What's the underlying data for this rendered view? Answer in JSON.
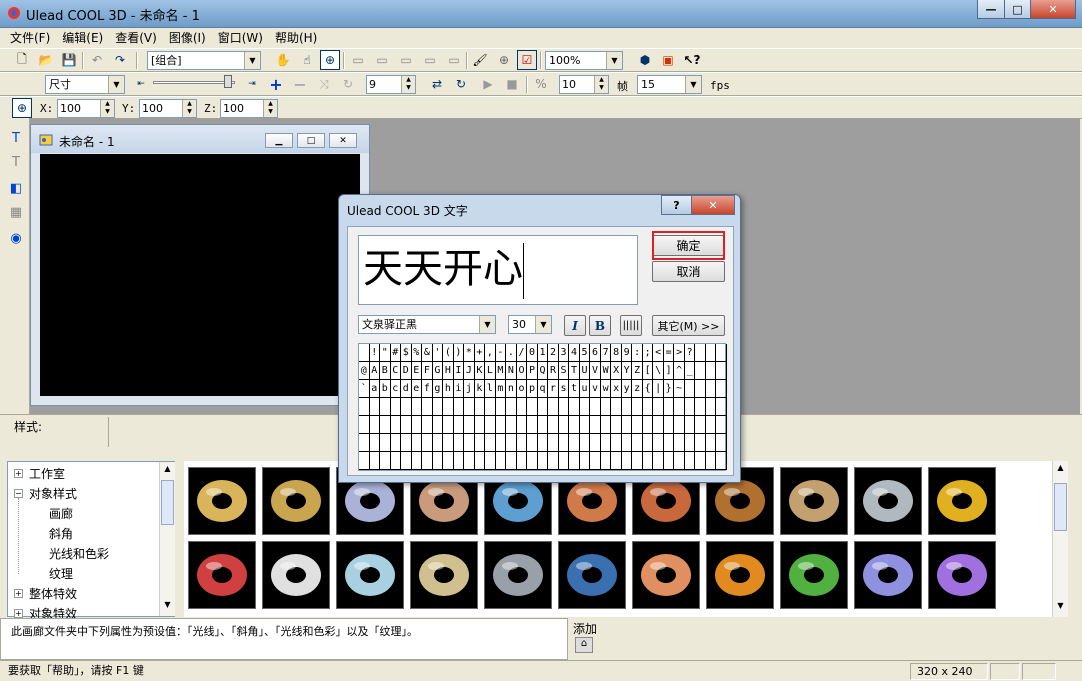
{
  "window": {
    "title": "Ulead COOL 3D - 未命名 - 1",
    "min": "—",
    "max": "□",
    "close": "✕"
  },
  "menu": [
    "文件(F)",
    "编辑(E)",
    "查看(V)",
    "图像(I)",
    "窗口(W)",
    "帮助(H)"
  ],
  "toolbar1": {
    "object_combo": "[组合]",
    "zoom_combo": "100%"
  },
  "toolbar2": {
    "size_combo": "尺寸",
    "frame_value": "9",
    "frames_total": "10",
    "frame_label": "帧",
    "fps_value": "15",
    "fps_label": "fps"
  },
  "toolbar3": {
    "x_label": "X:",
    "x_value": "100",
    "y_label": "Y:",
    "y_value": "100",
    "z_label": "Z:",
    "z_value": "100"
  },
  "doc": {
    "title": "未命名 - 1"
  },
  "style_label": "样式:",
  "tree": {
    "items": [
      {
        "label": "工作室",
        "expander": "+"
      },
      {
        "label": "对象样式",
        "expander": "−"
      },
      {
        "label": "画廊",
        "expander": ""
      },
      {
        "label": "斜角",
        "expander": ""
      },
      {
        "label": "光线和色彩",
        "expander": ""
      },
      {
        "label": "纹理",
        "expander": ""
      },
      {
        "label": "整体特效",
        "expander": "+"
      },
      {
        "label": "对象特效",
        "expander": "+"
      }
    ]
  },
  "thumbs": {
    "row1": [
      "#d9b45a",
      "#c9a550",
      "#aab2d8",
      "#c99a7c",
      "#5c9fd0",
      "#d07a4a",
      "#c8683c",
      "#b07030",
      "#c2a070",
      "#b0b8c0",
      "#e0b020"
    ],
    "row2": [
      "#d04040",
      "#e0e0e0",
      "#a8d0e0",
      "#d0c090",
      "#9aa0a8",
      "#3a70b0",
      "#e09060",
      "#e08a20",
      "#50b040",
      "#9090e0",
      "#a070e0"
    ]
  },
  "description": "此画廊文件夹中下列属性为预设值：「光线」、「斜角」、「光线和色彩」以及「纹理」。",
  "add_label": "添加",
  "status": {
    "help_text": "要获取「帮助」，请按 F1 键",
    "size": "320 x 240"
  },
  "dialog": {
    "title": "Ulead COOL 3D 文字",
    "help_btn": "?",
    "close_btn": "✕",
    "text_value": "天天开心",
    "ok_label": "确定",
    "cancel_label": "取消",
    "font_combo": "文泉驿正黑",
    "size_combo": "30",
    "italic_label": "I",
    "bold_label": "B",
    "other_label": "其它(M) >>",
    "charmap": [
      " !\"#$%&'()*+,-./0123456789:;<=>?",
      "@ABCDEFGHIJKLMNOPQRSTUVWXYZ[\\]^_",
      "`abcdefghijklmnopqrstuvwxyz{|}~ "
    ]
  }
}
